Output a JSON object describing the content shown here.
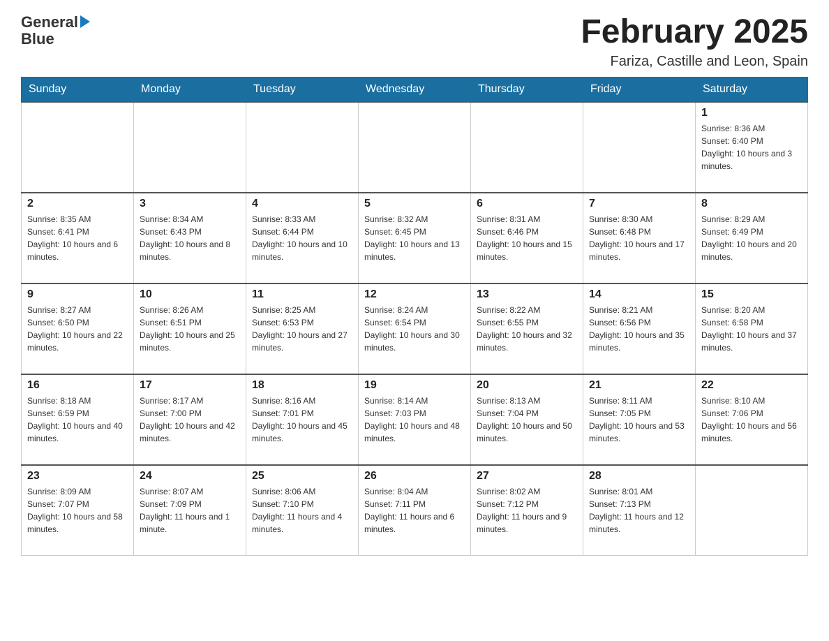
{
  "logo": {
    "text_general": "General",
    "text_blue": "Blue"
  },
  "header": {
    "title": "February 2025",
    "subtitle": "Fariza, Castille and Leon, Spain"
  },
  "days_of_week": [
    "Sunday",
    "Monday",
    "Tuesday",
    "Wednesday",
    "Thursday",
    "Friday",
    "Saturday"
  ],
  "weeks": [
    [
      {
        "day": "",
        "info": ""
      },
      {
        "day": "",
        "info": ""
      },
      {
        "day": "",
        "info": ""
      },
      {
        "day": "",
        "info": ""
      },
      {
        "day": "",
        "info": ""
      },
      {
        "day": "",
        "info": ""
      },
      {
        "day": "1",
        "info": "Sunrise: 8:36 AM\nSunset: 6:40 PM\nDaylight: 10 hours and 3 minutes."
      }
    ],
    [
      {
        "day": "2",
        "info": "Sunrise: 8:35 AM\nSunset: 6:41 PM\nDaylight: 10 hours and 6 minutes."
      },
      {
        "day": "3",
        "info": "Sunrise: 8:34 AM\nSunset: 6:43 PM\nDaylight: 10 hours and 8 minutes."
      },
      {
        "day": "4",
        "info": "Sunrise: 8:33 AM\nSunset: 6:44 PM\nDaylight: 10 hours and 10 minutes."
      },
      {
        "day": "5",
        "info": "Sunrise: 8:32 AM\nSunset: 6:45 PM\nDaylight: 10 hours and 13 minutes."
      },
      {
        "day": "6",
        "info": "Sunrise: 8:31 AM\nSunset: 6:46 PM\nDaylight: 10 hours and 15 minutes."
      },
      {
        "day": "7",
        "info": "Sunrise: 8:30 AM\nSunset: 6:48 PM\nDaylight: 10 hours and 17 minutes."
      },
      {
        "day": "8",
        "info": "Sunrise: 8:29 AM\nSunset: 6:49 PM\nDaylight: 10 hours and 20 minutes."
      }
    ],
    [
      {
        "day": "9",
        "info": "Sunrise: 8:27 AM\nSunset: 6:50 PM\nDaylight: 10 hours and 22 minutes."
      },
      {
        "day": "10",
        "info": "Sunrise: 8:26 AM\nSunset: 6:51 PM\nDaylight: 10 hours and 25 minutes."
      },
      {
        "day": "11",
        "info": "Sunrise: 8:25 AM\nSunset: 6:53 PM\nDaylight: 10 hours and 27 minutes."
      },
      {
        "day": "12",
        "info": "Sunrise: 8:24 AM\nSunset: 6:54 PM\nDaylight: 10 hours and 30 minutes."
      },
      {
        "day": "13",
        "info": "Sunrise: 8:22 AM\nSunset: 6:55 PM\nDaylight: 10 hours and 32 minutes."
      },
      {
        "day": "14",
        "info": "Sunrise: 8:21 AM\nSunset: 6:56 PM\nDaylight: 10 hours and 35 minutes."
      },
      {
        "day": "15",
        "info": "Sunrise: 8:20 AM\nSunset: 6:58 PM\nDaylight: 10 hours and 37 minutes."
      }
    ],
    [
      {
        "day": "16",
        "info": "Sunrise: 8:18 AM\nSunset: 6:59 PM\nDaylight: 10 hours and 40 minutes."
      },
      {
        "day": "17",
        "info": "Sunrise: 8:17 AM\nSunset: 7:00 PM\nDaylight: 10 hours and 42 minutes."
      },
      {
        "day": "18",
        "info": "Sunrise: 8:16 AM\nSunset: 7:01 PM\nDaylight: 10 hours and 45 minutes."
      },
      {
        "day": "19",
        "info": "Sunrise: 8:14 AM\nSunset: 7:03 PM\nDaylight: 10 hours and 48 minutes."
      },
      {
        "day": "20",
        "info": "Sunrise: 8:13 AM\nSunset: 7:04 PM\nDaylight: 10 hours and 50 minutes."
      },
      {
        "day": "21",
        "info": "Sunrise: 8:11 AM\nSunset: 7:05 PM\nDaylight: 10 hours and 53 minutes."
      },
      {
        "day": "22",
        "info": "Sunrise: 8:10 AM\nSunset: 7:06 PM\nDaylight: 10 hours and 56 minutes."
      }
    ],
    [
      {
        "day": "23",
        "info": "Sunrise: 8:09 AM\nSunset: 7:07 PM\nDaylight: 10 hours and 58 minutes."
      },
      {
        "day": "24",
        "info": "Sunrise: 8:07 AM\nSunset: 7:09 PM\nDaylight: 11 hours and 1 minute."
      },
      {
        "day": "25",
        "info": "Sunrise: 8:06 AM\nSunset: 7:10 PM\nDaylight: 11 hours and 4 minutes."
      },
      {
        "day": "26",
        "info": "Sunrise: 8:04 AM\nSunset: 7:11 PM\nDaylight: 11 hours and 6 minutes."
      },
      {
        "day": "27",
        "info": "Sunrise: 8:02 AM\nSunset: 7:12 PM\nDaylight: 11 hours and 9 minutes."
      },
      {
        "day": "28",
        "info": "Sunrise: 8:01 AM\nSunset: 7:13 PM\nDaylight: 11 hours and 12 minutes."
      },
      {
        "day": "",
        "info": ""
      }
    ]
  ]
}
